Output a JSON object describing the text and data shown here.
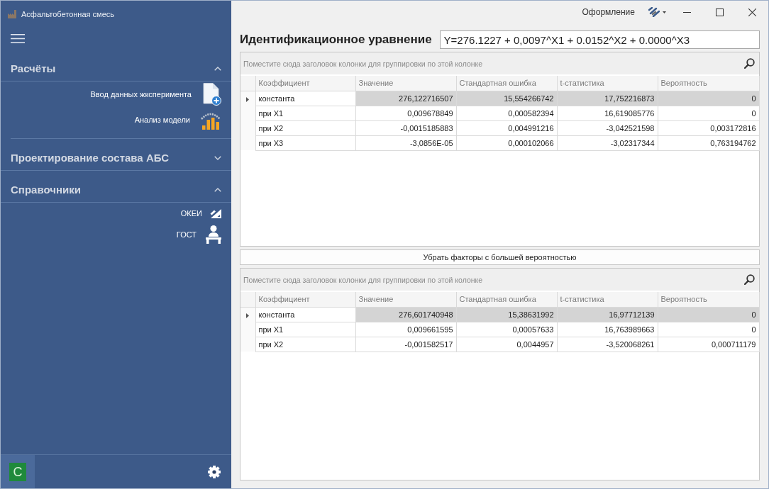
{
  "sidebar": {
    "title": "Асфальтобетонная смесь",
    "groups": [
      {
        "label": "Расчёты",
        "expanded": true,
        "items": [
          {
            "label": "Ввод данных жксперимента"
          },
          {
            "label": "Анализ модели"
          }
        ]
      },
      {
        "label": "Проектирование состава АБС",
        "expanded": false
      },
      {
        "label": "Справочники",
        "expanded": true,
        "items": [
          {
            "label": "ОКЕИ"
          },
          {
            "label": "ГОСТ"
          }
        ]
      }
    ],
    "footer": {
      "badge": "C"
    }
  },
  "title_bar": {
    "menu": "Оформление"
  },
  "equation": {
    "label": "Идентификационное уравнение",
    "value": "Y=276.1227 + 0,0097^X1 + 0.0152^X2 + 0.0000^X3"
  },
  "table_top": {
    "group_panel_hint": "Поместите сюда заголовок колонки для группировки по этой колонке",
    "columns": [
      "Коэффициент",
      "Значение",
      "Стандартная ошибка",
      "t-статистика",
      "Вероятность"
    ],
    "rows": [
      {
        "selected": true,
        "cells": [
          "константа",
          "276,122716507",
          "15,554266742",
          "17,752216873",
          "0"
        ]
      },
      {
        "selected": false,
        "cells": [
          "при X1",
          "0,009678849",
          "0,000582394",
          "16,619085776",
          "0"
        ]
      },
      {
        "selected": false,
        "cells": [
          "при X2",
          "-0,0015185883",
          "0,004991216",
          "-3,042521598",
          "0,003172816"
        ]
      },
      {
        "selected": false,
        "cells": [
          "при X3",
          "-3,0856E-05",
          "0,000102066",
          "-3,02317344",
          "0,763194762"
        ]
      }
    ]
  },
  "button": {
    "label": "Убрать факторы с большей вероятностью"
  },
  "table_bottom": {
    "group_panel_hint": "Поместите сюда заголовок колонки для группировки по этой колонке",
    "columns": [
      "Коэффициент",
      "Значение",
      "Стандартная ошибка",
      "t-статистика",
      "Вероятность"
    ],
    "rows": [
      {
        "selected": true,
        "cells": [
          "константа",
          "276,601740948",
          "15,38631992",
          "16,97712139",
          "0"
        ]
      },
      {
        "selected": false,
        "cells": [
          "при X1",
          "0,009661595",
          "0,00057633",
          "16,763989663",
          "0"
        ]
      },
      {
        "selected": false,
        "cells": [
          "при X2",
          "-0,001582517",
          "0,0044957",
          "-3,520068261",
          "0,000711179"
        ]
      }
    ]
  }
}
